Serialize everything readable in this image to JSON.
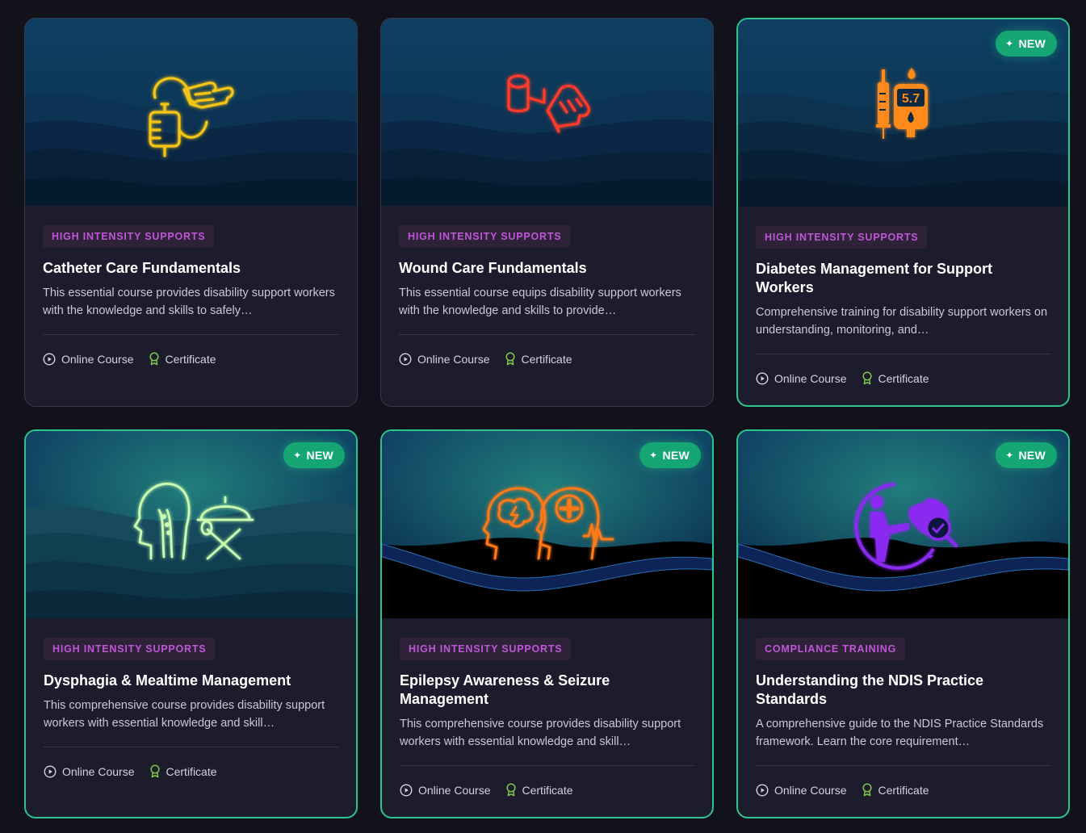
{
  "colors": {
    "page_bg": "#12121c",
    "card_bg": "#1d1c2c",
    "new_border": "#2ec48e",
    "new_badge": "#16a673",
    "category_text": "#c056d8",
    "category_bg": "#2d2238",
    "certificate_icon": "#7ec84a"
  },
  "courses": [
    {
      "category": "HIGH INTENSITY SUPPORTS",
      "title": "Catheter Care Fundamentals",
      "description": "This essential course provides disability support workers with the knowledge and skills to safely…",
      "type": "Online Course",
      "credential": "Certificate",
      "is_new": false,
      "icon": "catheter-bag-hand-icon",
      "icon_color": "#f5c518"
    },
    {
      "category": "HIGH INTENSITY SUPPORTS",
      "title": "Wound Care Fundamentals",
      "description": "This essential course equips disability support workers with the knowledge and skills to provide…",
      "type": "Online Course",
      "credential": "Certificate",
      "is_new": false,
      "icon": "bandage-glove-icon",
      "icon_color": "#ff3a2a"
    },
    {
      "category": "HIGH INTENSITY SUPPORTS",
      "title": "Diabetes Management for Support Workers",
      "description": "Comprehensive training for disability support workers on understanding, monitoring, and…",
      "type": "Online Course",
      "credential": "Certificate",
      "is_new": true,
      "badge": "NEW",
      "icon": "syringe-glucose-meter-icon",
      "icon_color": "#ff8a1e",
      "icon_text": "5.7"
    },
    {
      "category": "HIGH INTENSITY SUPPORTS",
      "title": "Dysphagia & Mealtime Management",
      "description": "This comprehensive course provides disability support workers with essential knowledge and skill…",
      "type": "Online Course",
      "credential": "Certificate",
      "is_new": true,
      "badge": "NEW",
      "icon": "swallowing-head-cloche-icon",
      "icon_color": "#c8ffb0"
    },
    {
      "category": "HIGH INTENSITY SUPPORTS",
      "title": "Epilepsy Awareness & Seizure Management",
      "description": "This comprehensive course provides disability support workers with essential knowledge and skill…",
      "type": "Online Course",
      "credential": "Certificate",
      "is_new": true,
      "badge": "NEW",
      "icon": "brain-seizure-icon",
      "icon_color": "#ff7a18"
    },
    {
      "category": "COMPLIANCE TRAINING",
      "title": "Understanding the NDIS Practice Standards",
      "description": "A comprehensive guide to the NDIS Practice Standards framework. Learn the core requirement…",
      "type": "Online Course",
      "credential": "Certificate",
      "is_new": true,
      "badge": "NEW",
      "icon": "person-australia-check-icon",
      "icon_color": "#8a2cf0"
    }
  ]
}
